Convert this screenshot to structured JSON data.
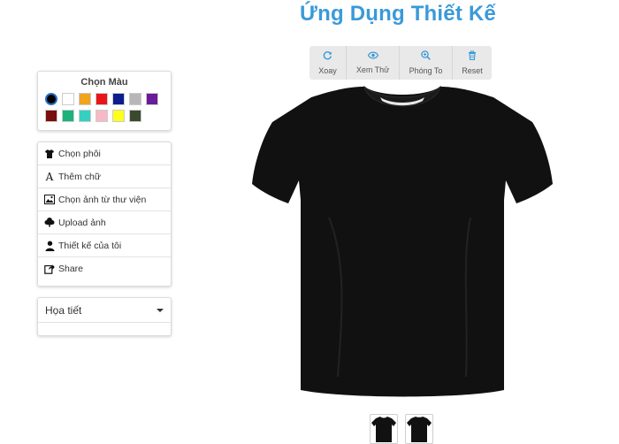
{
  "app": {
    "title": "Ứng Dụng Thiết Kế"
  },
  "colors": {
    "title": "Chọn Màu",
    "swatches": [
      "#000000",
      "#ffffff",
      "#f0a51a",
      "#e8161b",
      "#0b1e8c",
      "#b7b7b7",
      "#6a1b9a",
      "#7a0e0e",
      "#1db27a",
      "#35d1c0",
      "#f7b8c8",
      "#ffff1a",
      "#3b4a2e"
    ],
    "selected": "#000000"
  },
  "menu": {
    "items": [
      {
        "label": "Chọn phôi",
        "icon": "tshirt-icon"
      },
      {
        "label": "Thêm chữ",
        "icon": "font-icon"
      },
      {
        "label": "Chọn ảnh từ thư viện",
        "icon": "picture-icon"
      },
      {
        "label": "Upload ảnh",
        "icon": "cloud-upload-icon"
      },
      {
        "label": "Thiết kế của tôi",
        "icon": "user-icon"
      },
      {
        "label": "Share",
        "icon": "share-icon"
      }
    ]
  },
  "pattern": {
    "label": "Họa tiết"
  },
  "toolbar": {
    "buttons": [
      {
        "label": "Xoay",
        "icon": "rotate-icon"
      },
      {
        "label": "Xem Thử",
        "icon": "eye-icon"
      },
      {
        "label": "Phóng To",
        "icon": "zoom-in-icon"
      },
      {
        "label": "Reset",
        "icon": "trash-icon"
      }
    ]
  },
  "product": {
    "shirt_color": "#111111",
    "views": [
      "front",
      "back"
    ]
  }
}
